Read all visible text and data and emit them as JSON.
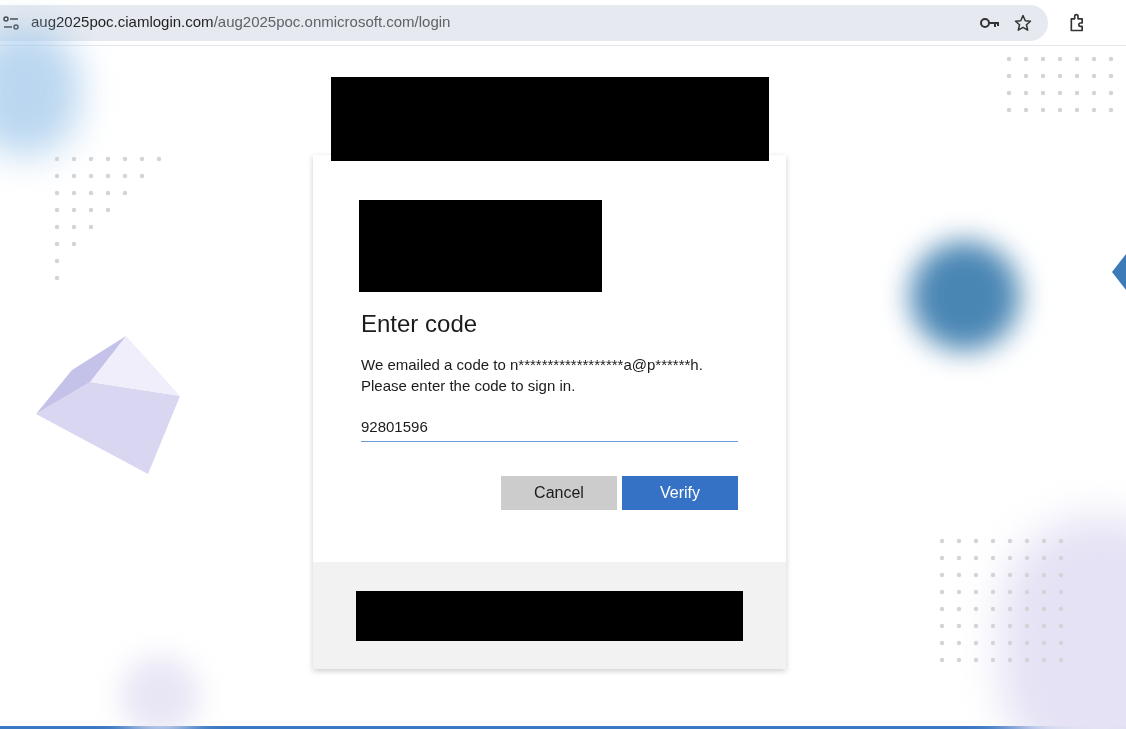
{
  "address_bar": {
    "host": "aug2025poc.ciamlogin.com",
    "path": "/aug2025poc.onmicrosoft.com/login"
  },
  "dialog": {
    "title": "Enter code",
    "message_lines": [
      "We emailed a code to n******************a@p******h.",
      "Please enter the code to sign in."
    ],
    "code_field": {
      "value": "92801596"
    },
    "buttons": [
      {
        "label": "Cancel",
        "kind": "secondary"
      },
      {
        "label": "Verify",
        "kind": "primary"
      }
    ]
  }
}
